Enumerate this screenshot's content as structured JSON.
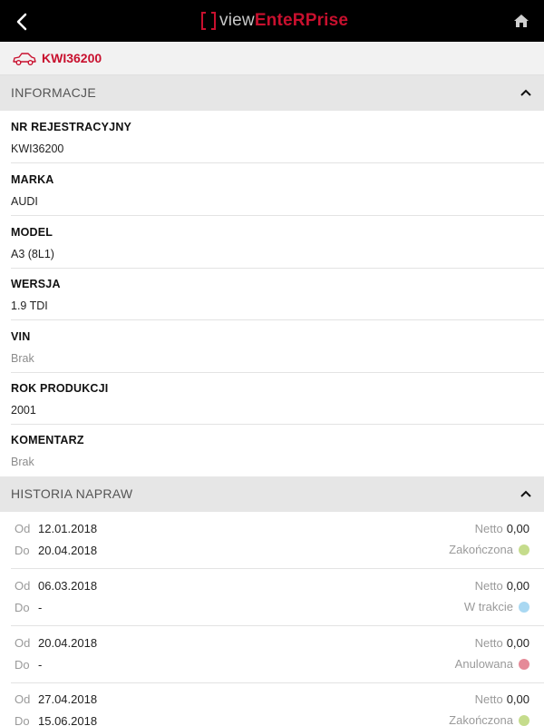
{
  "topbar": {
    "logo_prefix": "view",
    "logo_suffix": "EnteRPrise",
    "back_icon": "back-arrow-icon",
    "home_icon": "home-icon"
  },
  "vehicle": {
    "plate": "KWI36200",
    "icon": "car-icon"
  },
  "sections": {
    "info_title": "INFORMACJE",
    "history_title": "HISTORIA NAPRAW"
  },
  "info": [
    {
      "label": "NR REJESTRACYJNY",
      "value": "KWI36200",
      "muted": false
    },
    {
      "label": "MARKA",
      "value": "AUDI",
      "muted": false
    },
    {
      "label": "MODEL",
      "value": "A3 (8L1)",
      "muted": false
    },
    {
      "label": "WERSJA",
      "value": "1.9 TDI",
      "muted": false
    },
    {
      "label": "VIN",
      "value": "Brak",
      "muted": true
    },
    {
      "label": "ROK PRODUKCJI",
      "value": "2001",
      "muted": false
    },
    {
      "label": "KOMENTARZ",
      "value": "Brak",
      "muted": true
    }
  ],
  "history_labels": {
    "from": "Od",
    "to": "Do",
    "netto": "Netto"
  },
  "history": [
    {
      "from": "12.01.2018",
      "to": "20.04.2018",
      "netto": "0,00",
      "status": "Zakończona",
      "status_color": "#c5dc8c"
    },
    {
      "from": "06.03.2018",
      "to": "-",
      "netto": "0,00",
      "status": "W trakcie",
      "status_color": "#a9d8f2"
    },
    {
      "from": "20.04.2018",
      "to": "-",
      "netto": "0,00",
      "status": "Anulowana",
      "status_color": "#e58a98"
    },
    {
      "from": "27.04.2018",
      "to": "15.06.2018",
      "netto": "0,00",
      "status": "Zakończona",
      "status_color": "#c5dc8c"
    }
  ],
  "colors": {
    "accent": "#c8102e",
    "header_bg": "#000000",
    "section_bg": "#e6e6e6"
  }
}
